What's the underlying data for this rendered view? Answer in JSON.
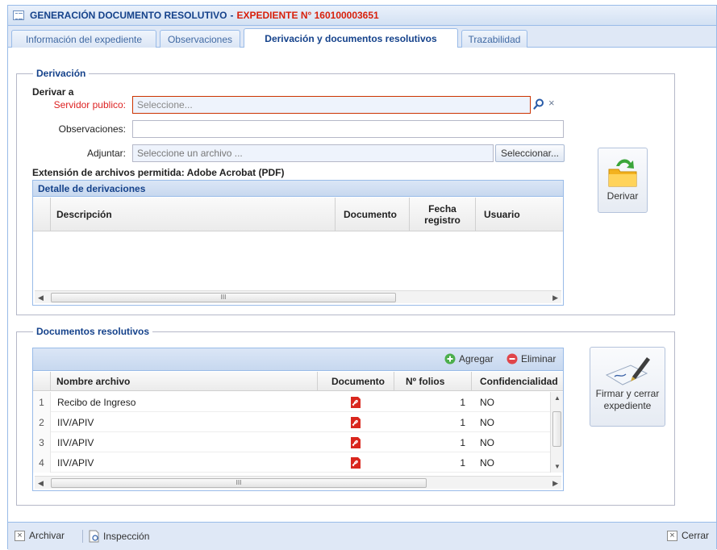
{
  "window": {
    "title_prefix": "GENERACIÓN DOCUMENTO RESOLUTIVO",
    "title_separator": "-",
    "title_expediente": "EXPEDIENTE N° 160100003651"
  },
  "tabs": [
    {
      "label": "Información del expediente"
    },
    {
      "label": "Observaciones"
    },
    {
      "label": "Derivación y documentos resolutivos"
    },
    {
      "label": "Trazabilidad"
    }
  ],
  "derivacion": {
    "legend": "Derivación",
    "derivar_a": "Derivar a",
    "servidor_label": "Servidor publico:",
    "servidor_placeholder": "Seleccione...",
    "observaciones_label": "Observaciones:",
    "observaciones_value": "",
    "adjuntar_label": "Adjuntar:",
    "adjuntar_placeholder": "Seleccione un archivo ...",
    "seleccionar_button": "Seleccionar...",
    "extension_note": "Extensión de archivos permitida: Adobe Acrobat (PDF)",
    "grid_title": "Detalle de derivaciones",
    "columns": [
      "Descripción",
      "Documento",
      "Fecha registro",
      "Usuario"
    ],
    "derivar_button": "Derivar"
  },
  "resolutivos": {
    "legend": "Documentos resolutivos",
    "agregar": "Agregar",
    "eliminar": "Eliminar",
    "columns": [
      "Nombre archivo",
      "Documento",
      "Nº folios",
      "Confidencialidad"
    ],
    "rows": [
      {
        "num": "1",
        "nombre": "Recibo de Ingreso",
        "folios": "1",
        "conf": "NO"
      },
      {
        "num": "2",
        "nombre": "IIV/APIV",
        "folios": "1",
        "conf": "NO"
      },
      {
        "num": "3",
        "nombre": "IIV/APIV",
        "folios": "1",
        "conf": "NO"
      },
      {
        "num": "4",
        "nombre": "IIV/APIV",
        "folios": "1",
        "conf": "NO"
      }
    ],
    "firmar_button": "Firmar y cerrar expediente"
  },
  "footer": {
    "archivar": "Archivar",
    "inspeccion": "Inspección",
    "cerrar": "Cerrar"
  },
  "colors": {
    "accent": "#15428b",
    "expediente": "#d8200b",
    "border": "#99bbe8"
  }
}
